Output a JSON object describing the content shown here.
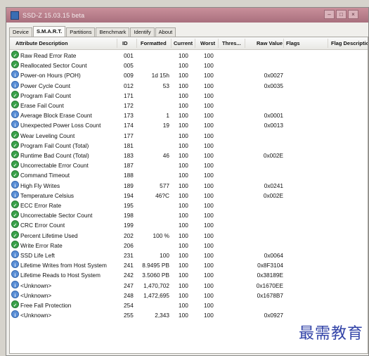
{
  "window": {
    "title": "SSD-Z 15.03.15 beta"
  },
  "tabs": [
    "Device",
    "S.M.A.R.T.",
    "Partitions",
    "Benchmark",
    "Identify",
    "About"
  ],
  "columns": {
    "attribute": "Attribute Description",
    "id": "ID",
    "formatted": "Formatted",
    "current": "Current",
    "worst": "Worst",
    "threshold": "Thres...",
    "raw": "Raw Value",
    "flags": "Flags",
    "flag_desc": "Flag Descriptio"
  },
  "rows": [
    {
      "status": "good",
      "name": "Raw Read Error Rate",
      "id": "001",
      "formatted": "",
      "current": "100",
      "worst": "100",
      "raw": ""
    },
    {
      "status": "good",
      "name": "Reallocated Sector Count",
      "id": "005",
      "formatted": "",
      "current": "100",
      "worst": "100",
      "raw": ""
    },
    {
      "status": "info",
      "name": "Power-on Hours (POH)",
      "id": "009",
      "formatted": "1d 15h",
      "current": "100",
      "worst": "100",
      "raw": "0x0027"
    },
    {
      "status": "info",
      "name": "Power Cycle Count",
      "id": "012",
      "formatted": "53",
      "current": "100",
      "worst": "100",
      "raw": "0x0035"
    },
    {
      "status": "good",
      "name": "Program Fail Count",
      "id": "171",
      "formatted": "",
      "current": "100",
      "worst": "100",
      "raw": ""
    },
    {
      "status": "good",
      "name": "Erase Fail Count",
      "id": "172",
      "formatted": "",
      "current": "100",
      "worst": "100",
      "raw": ""
    },
    {
      "status": "info",
      "name": "Average Block Erase Count",
      "id": "173",
      "formatted": "1",
      "current": "100",
      "worst": "100",
      "raw": "0x0001"
    },
    {
      "status": "info",
      "name": "Unexpected Power Loss Count",
      "id": "174",
      "formatted": "19",
      "current": "100",
      "worst": "100",
      "raw": "0x0013"
    },
    {
      "status": "good",
      "name": "Wear Leveling Count",
      "id": "177",
      "formatted": "",
      "current": "100",
      "worst": "100",
      "raw": ""
    },
    {
      "status": "good",
      "name": "Program Fail Count (Total)",
      "id": "181",
      "formatted": "",
      "current": "100",
      "worst": "100",
      "raw": ""
    },
    {
      "status": "good",
      "name": "Runtime Bad Count (Total)",
      "id": "183",
      "formatted": "46",
      "current": "100",
      "worst": "100",
      "raw": "0x002E"
    },
    {
      "status": "good",
      "name": "Uncorrectable Error Count",
      "id": "187",
      "formatted": "",
      "current": "100",
      "worst": "100",
      "raw": ""
    },
    {
      "status": "good",
      "name": "Command Timeout",
      "id": "188",
      "formatted": "",
      "current": "100",
      "worst": "100",
      "raw": ""
    },
    {
      "status": "info",
      "name": "High Fly Writes",
      "id": "189",
      "formatted": "577",
      "current": "100",
      "worst": "100",
      "raw": "0x0241"
    },
    {
      "status": "info",
      "name": "Temperature Celsius",
      "id": "194",
      "formatted": "46?C",
      "current": "100",
      "worst": "100",
      "raw": "0x002E"
    },
    {
      "status": "good",
      "name": "ECC Error Rate",
      "id": "195",
      "formatted": "",
      "current": "100",
      "worst": "100",
      "raw": ""
    },
    {
      "status": "good",
      "name": "Uncorrectable Sector Count",
      "id": "198",
      "formatted": "",
      "current": "100",
      "worst": "100",
      "raw": ""
    },
    {
      "status": "good",
      "name": "CRC Error Count",
      "id": "199",
      "formatted": "",
      "current": "100",
      "worst": "100",
      "raw": ""
    },
    {
      "status": "good",
      "name": "Percent Lifetime Used",
      "id": "202",
      "formatted": "100 %",
      "current": "100",
      "worst": "100",
      "raw": ""
    },
    {
      "status": "good",
      "name": "Write Error Rate",
      "id": "206",
      "formatted": "",
      "current": "100",
      "worst": "100",
      "raw": ""
    },
    {
      "status": "info",
      "name": "SSD Life Left",
      "id": "231",
      "formatted": "100",
      "current": "100",
      "worst": "100",
      "raw": "0x0064"
    },
    {
      "status": "info",
      "name": "Lifetime Writes from Host System",
      "id": "241",
      "formatted": "8.9495 PB",
      "current": "100",
      "worst": "100",
      "raw": "0x8F3104"
    },
    {
      "status": "info",
      "name": "Lifetime Reads to Host System",
      "id": "242",
      "formatted": "3.5060 PB",
      "current": "100",
      "worst": "100",
      "raw": "0x38189E"
    },
    {
      "status": "info",
      "name": "<Unknown>",
      "id": "247",
      "formatted": "1,470,702",
      "current": "100",
      "worst": "100",
      "raw": "0x1670EE"
    },
    {
      "status": "info",
      "name": "<Unknown>",
      "id": "248",
      "formatted": "1,472,695",
      "current": "100",
      "worst": "100",
      "raw": "0x1678B7"
    },
    {
      "status": "good",
      "name": "Free Fall Protection",
      "id": "254",
      "formatted": "",
      "current": "100",
      "worst": "100",
      "raw": ""
    },
    {
      "status": "info",
      "name": "<Unknown>",
      "id": "255",
      "formatted": "2,343",
      "current": "100",
      "worst": "100",
      "raw": "0x0927"
    }
  ],
  "watermark": "最需教育"
}
